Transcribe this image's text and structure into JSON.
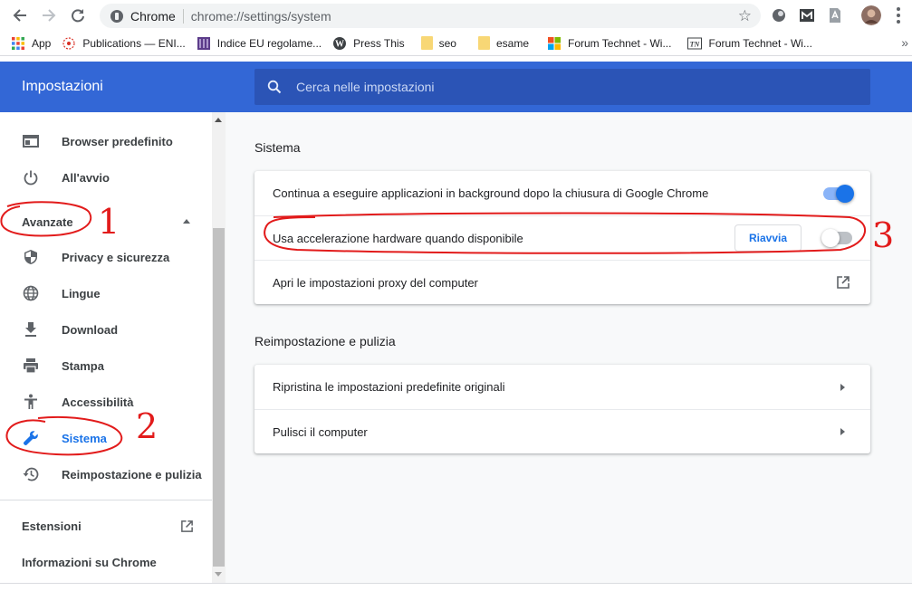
{
  "browser": {
    "omnibox_chip": "Chrome",
    "url": "chrome://settings/system"
  },
  "bookmarks": [
    {
      "label": "App",
      "icon": "apps-grid-icon"
    },
    {
      "label": "Publications — ENI...",
      "icon": "eni-favicon-icon"
    },
    {
      "label": "Indice EU regolame...",
      "icon": "eu-favicon-icon"
    },
    {
      "label": "Press This",
      "icon": "wordpress-favicon-icon"
    },
    {
      "label": "seo",
      "icon": "folder-icon"
    },
    {
      "label": "esame",
      "icon": "folder-icon"
    },
    {
      "label": "Forum Technet - Wi...",
      "icon": "microsoft-favicon-icon"
    },
    {
      "label": "Forum Technet - Wi...",
      "icon": "technet-favicon-icon"
    }
  ],
  "header": {
    "title": "Impostazioni",
    "search_placeholder": "Cerca nelle impostazioni"
  },
  "sidebar": {
    "items_top": [
      {
        "label": "Browser predefinito",
        "icon": "browser-icon"
      },
      {
        "label": "All'avvio",
        "icon": "power-icon"
      }
    ],
    "advanced_label": "Avanzate",
    "items_advanced": [
      {
        "label": "Privacy e sicurezza",
        "icon": "shield-icon"
      },
      {
        "label": "Lingue",
        "icon": "globe-icon"
      },
      {
        "label": "Download",
        "icon": "download-icon"
      },
      {
        "label": "Stampa",
        "icon": "printer-icon"
      },
      {
        "label": "Accessibilità",
        "icon": "accessibility-icon"
      },
      {
        "label": "Sistema",
        "icon": "wrench-icon",
        "active": true
      },
      {
        "label": "Reimpostazione e pulizia",
        "icon": "restore-icon"
      }
    ],
    "extensions_label": "Estensioni",
    "about_label": "Informazioni su Chrome"
  },
  "main": {
    "system": {
      "title": "Sistema",
      "rows": [
        {
          "label": "Continua a eseguire applicazioni in background dopo la chiusura di Google Chrome",
          "toggle": "on"
        },
        {
          "label": "Usa accelerazione hardware quando disponibile",
          "button": "Riavvia",
          "toggle": "off"
        },
        {
          "label": "Apri le impostazioni proxy del computer",
          "action": "open-external"
        }
      ]
    },
    "reset": {
      "title": "Reimpostazione e pulizia",
      "rows": [
        {
          "label": "Ripristina le impostazioni predefinite originali"
        },
        {
          "label": "Pulisci il computer"
        }
      ]
    }
  },
  "annotations": {
    "one": "1",
    "two": "2",
    "three": "3"
  },
  "colors": {
    "header": "#3367d6",
    "accent": "#1a73e8",
    "annotation": "#e21b1b"
  }
}
